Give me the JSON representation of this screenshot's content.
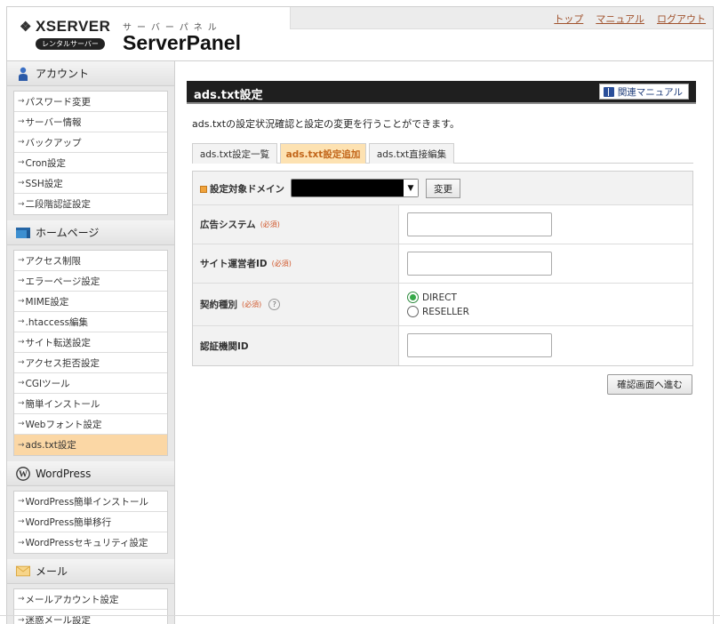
{
  "header": {
    "brand": "XSERVER",
    "badge": "レンタルサーバー",
    "panel_kana": "サーバーパネル",
    "panel_title": "ServerPanel",
    "links": [
      "トップ",
      "マニュアル",
      "ログアウト"
    ]
  },
  "sidebar": {
    "sections": [
      {
        "title": "アカウント",
        "icon": "person-icon",
        "items": [
          "パスワード変更",
          "サーバー情報",
          "バックアップ",
          "Cron設定",
          "SSH設定",
          "二段階認証設定"
        ]
      },
      {
        "title": "ホームページ",
        "icon": "homepage-icon",
        "items": [
          "アクセス制限",
          "エラーページ設定",
          "MIME設定",
          ".htaccess編集",
          "サイト転送設定",
          "アクセス拒否設定",
          "CGIツール",
          "簡単インストール",
          "Webフォント設定",
          "ads.txt設定"
        ]
      },
      {
        "title": "WordPress",
        "icon": "wordpress-icon",
        "items": [
          "WordPress簡単インストール",
          "WordPress簡単移行",
          "WordPressセキュリティ設定"
        ]
      },
      {
        "title": "メール",
        "icon": "mail-icon",
        "items": [
          "メールアカウント設定",
          "迷惑メール設定"
        ]
      }
    ],
    "active_item": "ads.txt設定"
  },
  "main": {
    "title": "ads.txt設定",
    "manual_button": "関連マニュアル",
    "description": "ads.txtの設定状況確認と設定の変更を行うことができます。",
    "tabs": [
      "ads.txt設定一覧",
      "ads.txt設定追加",
      "ads.txt直接編集"
    ],
    "active_tab": "ads.txt設定追加",
    "domain_label": "設定対象ドメイン",
    "change_button": "変更",
    "required": "(必須)",
    "fields": {
      "ad_system": "広告システム",
      "publisher_id": "サイト運営者ID",
      "contract_type": "契約種別",
      "cert_id": "認証機関ID"
    },
    "radio_options": [
      "DIRECT",
      "RESELLER"
    ],
    "radio_selected": "DIRECT",
    "help_glyph": "?",
    "confirm_button": "確認画面へ進む"
  }
}
